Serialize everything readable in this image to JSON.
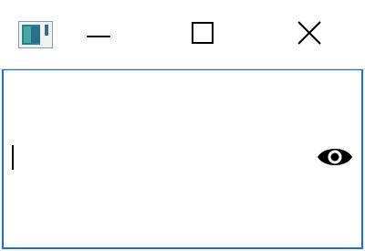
{
  "window": {
    "icon": "app-window-icon",
    "controls": {
      "minimize_icon": "minimize-icon",
      "maximize_icon": "maximize-icon",
      "close_icon": "close-icon"
    }
  },
  "password_field": {
    "value": "",
    "reveal_icon": "eye-icon"
  },
  "colors": {
    "focus_border": "#1e6fcf",
    "glyph": "#000000"
  }
}
